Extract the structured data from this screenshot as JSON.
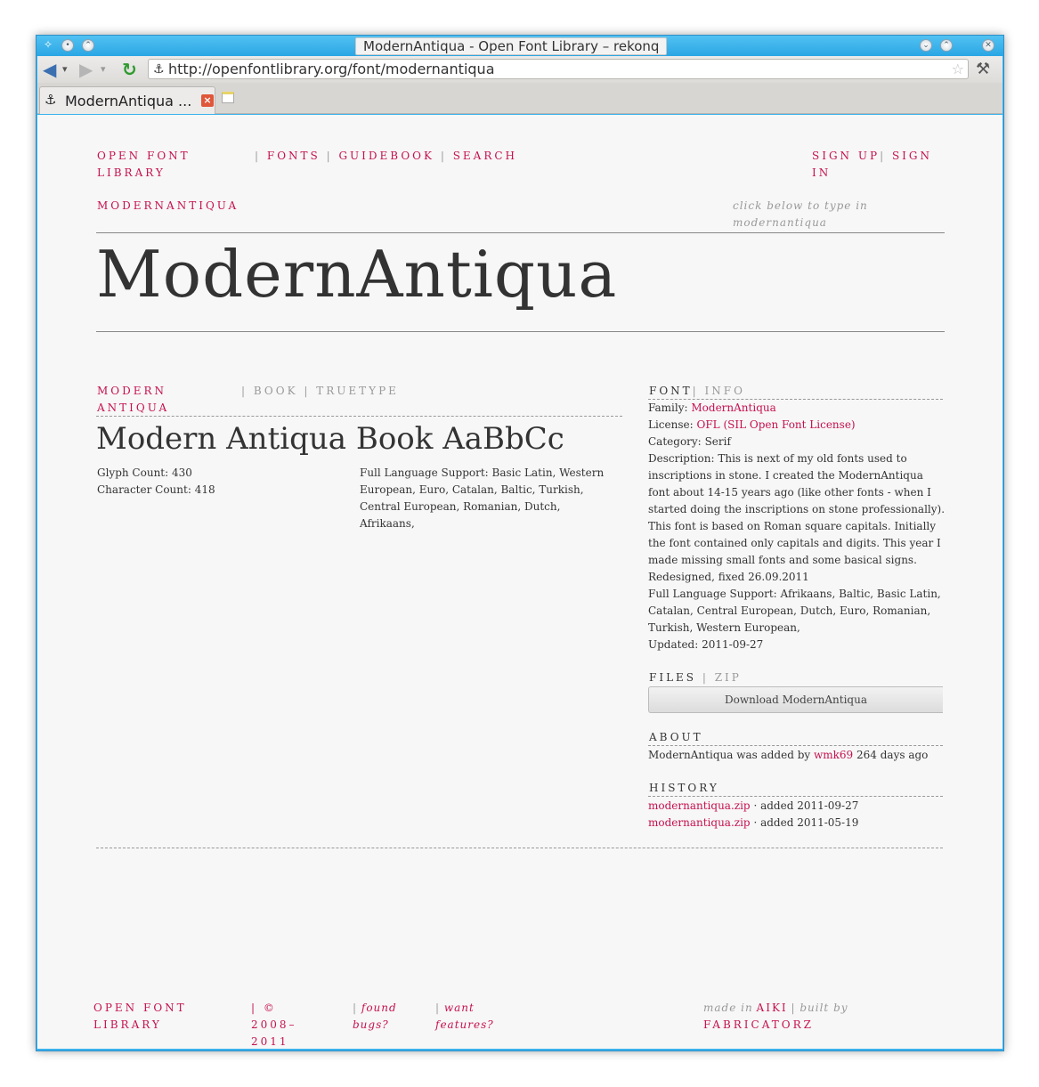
{
  "window": {
    "title": "ModernAntiqua - Open Font Library – rekonq"
  },
  "toolbar": {
    "url": "http://openfontlibrary.org/font/modernantiqua"
  },
  "tabs": [
    {
      "label": "ModernAntiqua ..."
    }
  ],
  "site": {
    "nav": {
      "brand": "OPEN FONT LIBRARY",
      "fonts": "FONTS",
      "guidebook": "GUIDEBOOK",
      "search": "SEARCH",
      "signup": "SIGN UP",
      "signin": "SIGN IN",
      "sep": "|"
    },
    "font_slug": "MODERNANTIQUA",
    "type_hint": "click below to type in modernantiqua",
    "preview_text": "ModernAntiqua",
    "style": {
      "name": "MODERN ANTIQUA",
      "weight": "BOOK",
      "format": "TRUETYPE",
      "sample": "Modern Antiqua Book AaBbCc",
      "glyph_label": "Glyph Count:",
      "glyph_value": "430",
      "char_label": "Character Count:",
      "char_value": "418",
      "lang_label": "Full Language Support:",
      "lang_value": "Basic Latin, Western European, Euro, Catalan, Baltic, Turkish, Central European, Romanian, Dutch, Afrikaans,"
    },
    "info": {
      "heading": "FONT",
      "heading2": "INFO",
      "family_label": "Family:",
      "family_value": "ModernAntiqua",
      "license_label": "License:",
      "license_value": "OFL (SIL Open Font License)",
      "category_label": "Category:",
      "category_value": "Serif",
      "description_label": "Description:",
      "description_value": "This is next of my old fonts used to inscriptions in stone. I created the ModernAntiqua font about 14-15 years ago (like other fonts - when I started doing the inscriptions on stone professionally). This font is based on Roman square capitals. Initially the font contained only capitals and digits. This year I made missing small fonts and some basical signs. Redesigned, fixed 26.09.2011",
      "lang_label": "Full Language Support:",
      "lang_value": "Afrikaans, Baltic, Basic Latin, Catalan, Central European, Dutch, Euro, Romanian, Turkish, Western European,",
      "updated_label": "Updated:",
      "updated_value": "2011-09-27"
    },
    "files": {
      "heading": "FILES",
      "heading2": "ZIP",
      "download_label": "Download ModernAntiqua"
    },
    "about": {
      "heading": "ABOUT",
      "text_before": "ModernAntiqua was added by",
      "user": "wmk69",
      "text_after": "264 days ago"
    },
    "history": {
      "heading": "HISTORY",
      "entries": [
        {
          "file": "modernantiqua.zip",
          "note": "· added 2011-09-27"
        },
        {
          "file": "modernantiqua.zip",
          "note": "· added 2011-05-19"
        }
      ]
    },
    "footer": {
      "brand": "OPEN FONT LIBRARY",
      "copyright": "| © 2008–2011",
      "bugs": "found bugs?",
      "features": "want features?",
      "made_in": "made in",
      "aiki": "AIKI",
      "built_by": "| built by",
      "fabricatorz": "FABRICATORZ"
    }
  }
}
